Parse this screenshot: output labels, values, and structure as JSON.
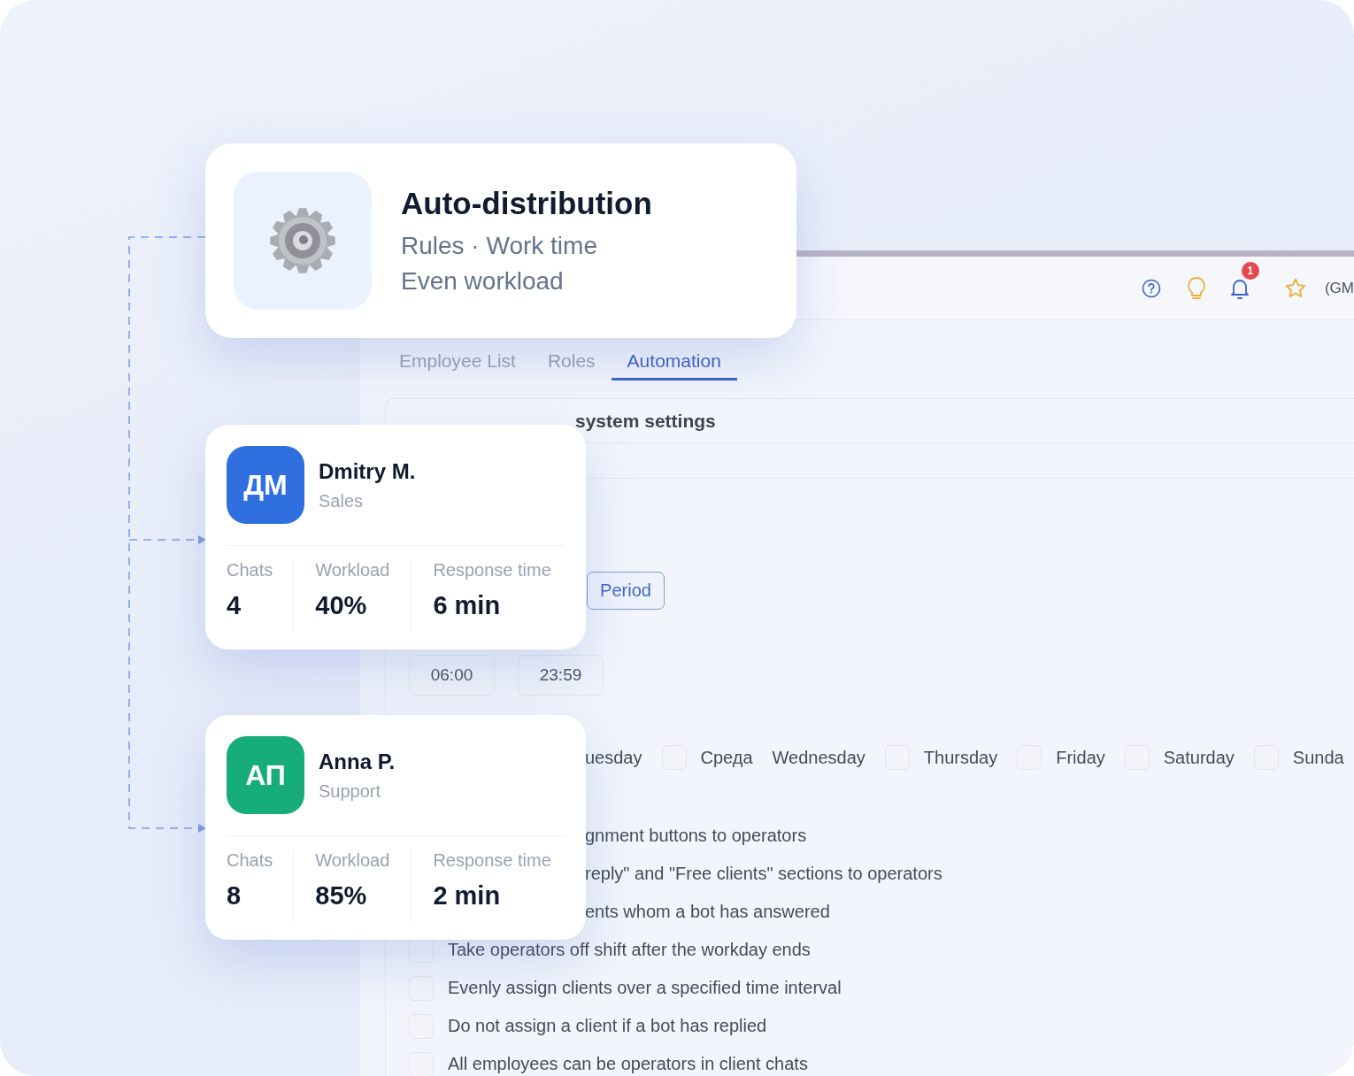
{
  "hero_card": {
    "title": "Auto-distribution",
    "lines": [
      "Rules · Work time",
      "Even workload"
    ]
  },
  "employees": [
    {
      "initials": "ДМ",
      "color": "#2f6fe0",
      "name": "Dmitry M.",
      "role": "Sales",
      "stats": [
        {
          "label": "Chats",
          "value": "4"
        },
        {
          "label": "Workload",
          "value": "40%"
        },
        {
          "label": "Response time",
          "value": "6 min"
        }
      ]
    },
    {
      "initials": "АП",
      "color": "#16ad78",
      "name": "Anna P.",
      "role": "Support",
      "stats": [
        {
          "label": "Chats",
          "value": "8"
        },
        {
          "label": "Workload",
          "value": "85%"
        },
        {
          "label": "Response time",
          "value": "2 min"
        }
      ]
    }
  ],
  "app": {
    "header": {
      "notification_count": "1",
      "timezone": "(GM"
    },
    "tabs": [
      {
        "label": "Employee List",
        "selected": false
      },
      {
        "label": "Roles",
        "selected": false
      },
      {
        "label": "Automation",
        "selected": true
      }
    ],
    "section_title": "system settings",
    "period_button": "Period",
    "times": [
      "06:00",
      "23:59"
    ],
    "weekdays": [
      {
        "label": "uesday"
      },
      {
        "label": "Среда",
        "checked": false
      },
      {
        "label": "Wednesday"
      },
      {
        "label": "Thursday",
        "checked": false
      },
      {
        "label": "Friday",
        "checked": false
      },
      {
        "label": "Saturday",
        "checked": false
      },
      {
        "label": "Sunda",
        "checked": false
      }
    ],
    "options": [
      {
        "label": "gnment buttons to operators"
      },
      {
        "label": "reply\" and \"Free clients\" sections to operators"
      },
      {
        "label": "ents whom a bot has answered"
      },
      {
        "label": "Take operators off shift after the workday ends",
        "checked": false
      },
      {
        "label": "Evenly assign clients over a specified time interval",
        "checked": false
      },
      {
        "label": "Do not assign a client if a bot has replied",
        "checked": false
      },
      {
        "label": "All employees can be operators in client chats",
        "checked": false
      }
    ]
  }
}
